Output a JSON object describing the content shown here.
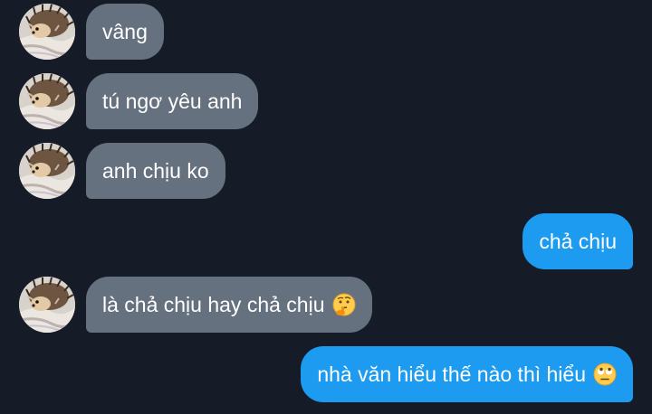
{
  "messages": [
    {
      "side": "in",
      "text": "vâng"
    },
    {
      "side": "in",
      "text": "tú ngơ yêu anh"
    },
    {
      "side": "in",
      "text": "anh chịu ko"
    },
    {
      "side": "out",
      "text": "chả chịu"
    },
    {
      "side": "in",
      "text": "là chả chịu hay chả chịu",
      "emoji": "thinking-face"
    },
    {
      "side": "out",
      "text": "nhà văn hiểu thế nào thì hiểu",
      "emoji": "face-with-rolling-eyes"
    }
  ],
  "colors": {
    "background": "#151c27",
    "incoming_bubble": "#66717f",
    "outgoing_bubble": "#1d9bf0",
    "text": "#ffffff"
  },
  "icons": {
    "avatar": "hedgehog-photo-avatar",
    "thinking": "thinking-face-emoji",
    "rolling_eyes": "rolling-eyes-emoji"
  }
}
